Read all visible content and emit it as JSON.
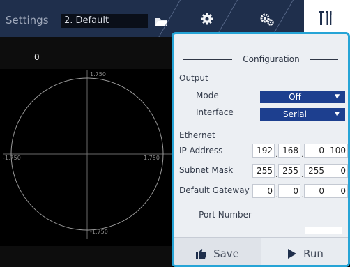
{
  "header": {
    "title": "Settings",
    "profile": "2. Default",
    "icons": [
      "folder-icon",
      "gear-icon",
      "gears-icon",
      "tools-icon"
    ]
  },
  "plot": {
    "value": "0",
    "ticks": {
      "top": "1.750",
      "bottom": "-1.750",
      "left": "-1.750",
      "right": "1.750"
    }
  },
  "config": {
    "title": "Configuration",
    "output": {
      "heading": "Output",
      "mode_label": "Mode",
      "mode_value": "Off",
      "interface_label": "Interface",
      "interface_value": "Serial"
    },
    "ethernet": {
      "heading": "Ethernet",
      "ip_label": "IP Address",
      "ip": [
        "192",
        "168",
        "0",
        "100"
      ],
      "subnet_label": "Subnet Mask",
      "subnet": [
        "255",
        "255",
        "255",
        "0"
      ],
      "gateway_label": "Default Gateway",
      "gateway": [
        "0",
        "0",
        "0",
        "0"
      ],
      "port_label": "- Port Number"
    },
    "save_label": "Save",
    "run_label": "Run"
  },
  "colors": {
    "accent": "#26a4d6",
    "select_bg": "#1d3f8f",
    "topbar": "#1f2f4c"
  }
}
